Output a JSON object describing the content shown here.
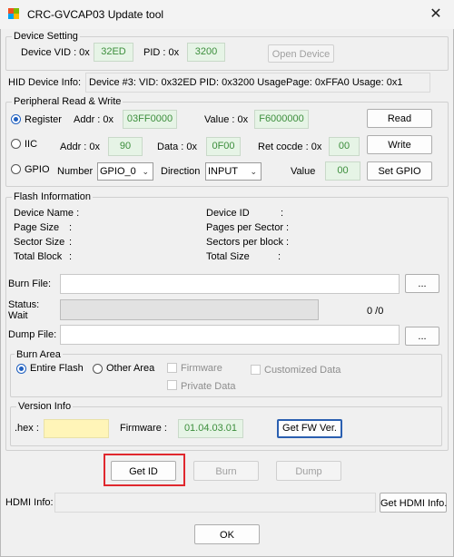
{
  "window": {
    "title": "CRC-GVCAP03 Update tool",
    "close_symbol": "✕"
  },
  "device_setting": {
    "legend": "Device Setting",
    "vid_label": "Device VID : 0x",
    "vid_value": "32ED",
    "pid_label": "PID : 0x",
    "pid_value": "3200",
    "open_button": "Open Device"
  },
  "hid_info": {
    "label": "HID Device Info:",
    "value": "Device #3: VID: 0x32ED  PID: 0x3200  UsagePage: 0xFFA0  Usage: 0x1"
  },
  "peripheral": {
    "legend": "Peripheral Read & Write",
    "register": {
      "label": "Register",
      "addr_label": "Addr : 0x",
      "addr_value": "03FF0000",
      "value_label": "Value : 0x",
      "value_value": "F6000000",
      "button": "Read"
    },
    "iic": {
      "label": "IIC",
      "addr_label": "Addr : 0x",
      "addr_value": "90",
      "data_label": "Data : 0x",
      "data_value": "0F00",
      "ret_label": "Ret cocde : 0x",
      "ret_value": "00",
      "button": "Write"
    },
    "gpio": {
      "label": "GPIO",
      "number_label": "Number",
      "number_value": "GPIO_0",
      "direction_label": "Direction",
      "direction_value": "INPUT",
      "value_label": "Value",
      "value_value": "00",
      "button": "Set GPIO"
    }
  },
  "flash": {
    "legend": "Flash Information",
    "device_name": "Device Name :",
    "device_id": "Device ID",
    "page_size": "Page Size",
    "pages_per_sector": "Pages per Sector :",
    "sector_size": "Sector Size",
    "sectors_per_block": "Sectors per block :",
    "total_block": "Total Block",
    "total_size": "Total Size",
    "colon": ":",
    "burn_file_label": "Burn File:",
    "browse": "...",
    "status_label": "Status:",
    "status_value": "Wait",
    "progress_text": "0 /0",
    "progress_fraction": 0,
    "dump_file_label": "Dump File:"
  },
  "burn_area": {
    "legend": "Burn Area",
    "entire_flash": "Entire Flash",
    "other_area": "Other Area",
    "firmware": "Firmware",
    "customized_data": "Customized Data",
    "private_data": "Private Data"
  },
  "version": {
    "legend": "Version Info",
    "hex_label": ".hex :",
    "firmware_label": "Firmware :",
    "firmware_value": "01.04.03.01",
    "get_fw_button": "Get FW Ver."
  },
  "actions": {
    "get_id": "Get ID",
    "burn": "Burn",
    "dump": "Dump"
  },
  "hdmi": {
    "label": "HDMI Info:",
    "button": "Get HDMI Info."
  },
  "ok": "OK",
  "colors": {
    "highlight": "#e0282e",
    "green_text": "#3c8e3c",
    "green_bg": "#e6f4e6",
    "hex_bg": "#fff5b8",
    "radio_blue": "#1f5fbf"
  },
  "icons": [
    "app-icon",
    "close-icon",
    "chevron-down-icon"
  ]
}
